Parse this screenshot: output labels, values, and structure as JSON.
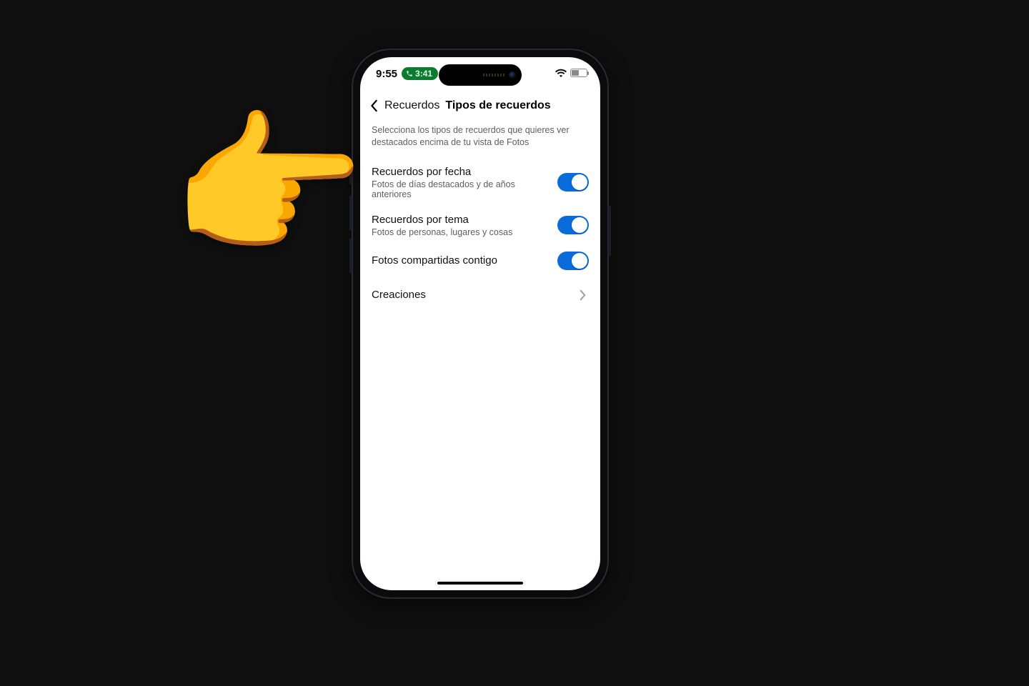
{
  "status": {
    "time": "9:55",
    "call_time": "3:41"
  },
  "nav": {
    "back_label": "Recuerdos",
    "title": "Tipos de recuerdos"
  },
  "description": "Selecciona los tipos de recuerdos que quieres ver destacados encima de tu vista de Fotos",
  "rows": {
    "date": {
      "title": "Recuerdos por fecha",
      "subtitle": "Fotos de días destacados y de años anteriores"
    },
    "theme": {
      "title": "Recuerdos por tema",
      "subtitle": "Fotos de personas, lugares y cosas"
    },
    "shared": {
      "title": "Fotos compartidas contigo"
    },
    "creations": {
      "title": "Creaciones"
    }
  }
}
